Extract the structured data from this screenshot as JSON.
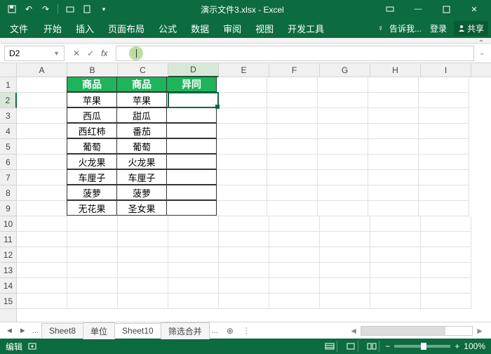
{
  "titlebar": {
    "filename": "演示文件3.xlsx - Excel"
  },
  "ribbon": {
    "file": "文件",
    "tabs": [
      "开始",
      "插入",
      "页面布局",
      "公式",
      "数据",
      "审阅",
      "视图",
      "开发工具"
    ],
    "tell_me": "告诉我...",
    "signin": "登录",
    "share": "共享"
  },
  "namebox": {
    "ref": "D2"
  },
  "formula_bar": {
    "value": ""
  },
  "columns": [
    "A",
    "B",
    "C",
    "D",
    "E",
    "F",
    "G",
    "H",
    "I"
  ],
  "rows": [
    "1",
    "2",
    "3",
    "4",
    "5",
    "6",
    "7",
    "8",
    "9",
    "10",
    "11",
    "12",
    "13",
    "14",
    "15"
  ],
  "active_col": "D",
  "active_row": "2",
  "table": {
    "headers": [
      "商品",
      "商品",
      "异同"
    ],
    "rows": [
      [
        "苹果",
        "苹果",
        ""
      ],
      [
        "西瓜",
        "甜瓜",
        ""
      ],
      [
        "西红柿",
        "番茄",
        ""
      ],
      [
        "葡萄",
        "葡萄",
        ""
      ],
      [
        "火龙果",
        "火龙果",
        ""
      ],
      [
        "车厘子",
        "车厘子",
        ""
      ],
      [
        "菠萝",
        "菠萝",
        ""
      ],
      [
        "无花果",
        "圣女果",
        ""
      ]
    ]
  },
  "sheet_tabs": {
    "items": [
      "Sheet8",
      "单位",
      "Sheet10",
      "筛选合并"
    ],
    "active": "Sheet10",
    "more": "..."
  },
  "statusbar": {
    "mode": "编辑",
    "zoom": "100%",
    "zoom_minus": "−",
    "zoom_plus": "+"
  }
}
